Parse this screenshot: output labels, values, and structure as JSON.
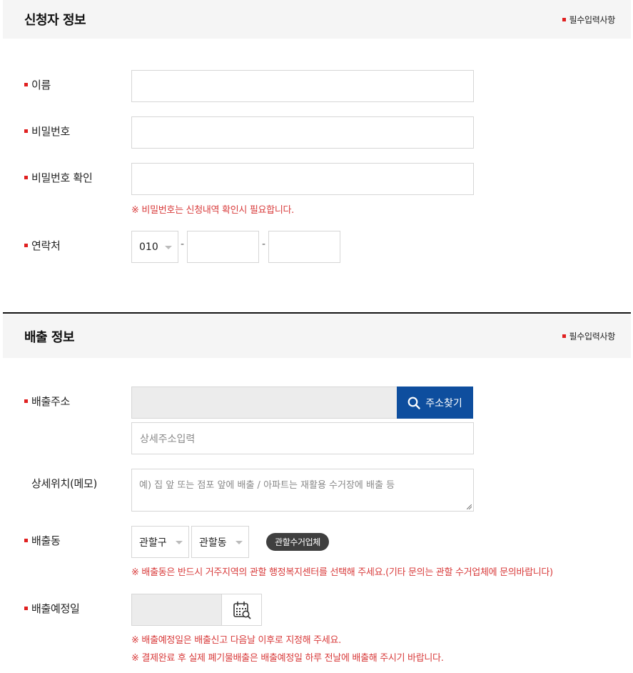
{
  "applicant_section": {
    "title": "신청자 정보",
    "required_note": "필수입력사항",
    "fields": {
      "name_label": "이름",
      "password_label": "비밀번호",
      "password_confirm_label": "비밀번호 확인",
      "password_notice": "※ 비밀번호는 신청내역 확인시 필요합니다.",
      "contact_label": "연락처",
      "contact_prefix": "010",
      "contact_dash": "-"
    }
  },
  "emission_section": {
    "title": "배출 정보",
    "required_note": "필수입력사항",
    "fields": {
      "address_label": "배출주소",
      "address_search_button": "주소찾기",
      "detail_address_placeholder": "상세주소입력",
      "memo_label": "상세위치(메모)",
      "memo_placeholder": "예) 집 앞 또는 점포 앞에 배출 / 아파트는 재활용 수거장에 배출 등",
      "district_label": "배출동",
      "gu_select": "관할구",
      "dong_select": "관할동",
      "collector_button": "관할수거업체",
      "district_notice": "※ 배출동은 반드시 거주지역의 관할 행정복지센터를 선택해 주세요.(기타 문의는 관할 수거업체에 문의바랍니다)",
      "date_label": "배출예정일",
      "date_notice_1": "※ 배출예정일은 배출신고 다음날 이후로 지정해 주세요.",
      "date_notice_2": "※ 결제완료 후 실제 폐기물배출은 배출예정일 하루 전날에 배출해 주시기 바랍니다."
    }
  },
  "colors": {
    "required_marker": "#e02020",
    "notice_text": "#d83a3a",
    "primary_button": "#0e4e9e",
    "pill_button": "#3f3f3f",
    "header_bg": "#f5f5f5",
    "disabled_input_bg": "#ececec"
  },
  "icons": {
    "search": "search-icon",
    "calendar": "calendar-icon"
  }
}
